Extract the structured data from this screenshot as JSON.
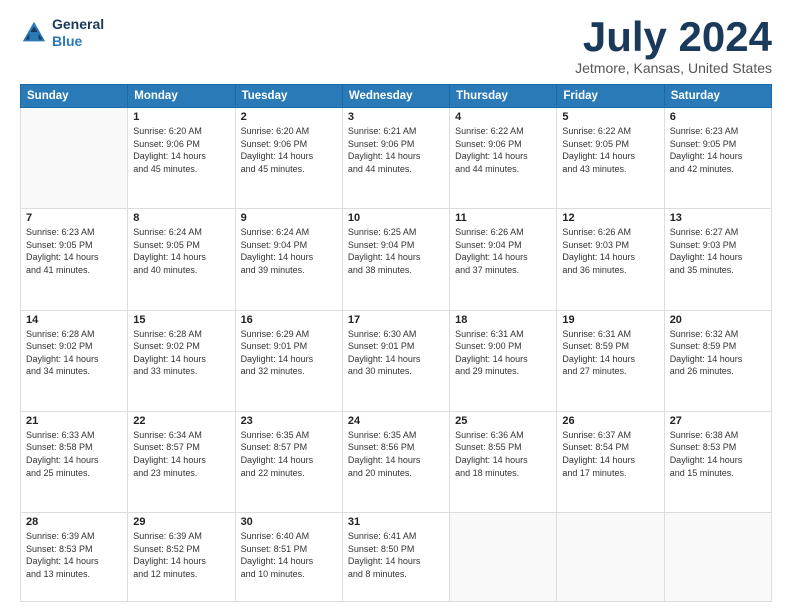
{
  "header": {
    "logo_line1": "General",
    "logo_line2": "Blue",
    "month": "July 2024",
    "location": "Jetmore, Kansas, United States"
  },
  "weekdays": [
    "Sunday",
    "Monday",
    "Tuesday",
    "Wednesday",
    "Thursday",
    "Friday",
    "Saturday"
  ],
  "weeks": [
    [
      {
        "day": "",
        "info": ""
      },
      {
        "day": "1",
        "info": "Sunrise: 6:20 AM\nSunset: 9:06 PM\nDaylight: 14 hours\nand 45 minutes."
      },
      {
        "day": "2",
        "info": "Sunrise: 6:20 AM\nSunset: 9:06 PM\nDaylight: 14 hours\nand 45 minutes."
      },
      {
        "day": "3",
        "info": "Sunrise: 6:21 AM\nSunset: 9:06 PM\nDaylight: 14 hours\nand 44 minutes."
      },
      {
        "day": "4",
        "info": "Sunrise: 6:22 AM\nSunset: 9:06 PM\nDaylight: 14 hours\nand 44 minutes."
      },
      {
        "day": "5",
        "info": "Sunrise: 6:22 AM\nSunset: 9:05 PM\nDaylight: 14 hours\nand 43 minutes."
      },
      {
        "day": "6",
        "info": "Sunrise: 6:23 AM\nSunset: 9:05 PM\nDaylight: 14 hours\nand 42 minutes."
      }
    ],
    [
      {
        "day": "7",
        "info": "Sunrise: 6:23 AM\nSunset: 9:05 PM\nDaylight: 14 hours\nand 41 minutes."
      },
      {
        "day": "8",
        "info": "Sunrise: 6:24 AM\nSunset: 9:05 PM\nDaylight: 14 hours\nand 40 minutes."
      },
      {
        "day": "9",
        "info": "Sunrise: 6:24 AM\nSunset: 9:04 PM\nDaylight: 14 hours\nand 39 minutes."
      },
      {
        "day": "10",
        "info": "Sunrise: 6:25 AM\nSunset: 9:04 PM\nDaylight: 14 hours\nand 38 minutes."
      },
      {
        "day": "11",
        "info": "Sunrise: 6:26 AM\nSunset: 9:04 PM\nDaylight: 14 hours\nand 37 minutes."
      },
      {
        "day": "12",
        "info": "Sunrise: 6:26 AM\nSunset: 9:03 PM\nDaylight: 14 hours\nand 36 minutes."
      },
      {
        "day": "13",
        "info": "Sunrise: 6:27 AM\nSunset: 9:03 PM\nDaylight: 14 hours\nand 35 minutes."
      }
    ],
    [
      {
        "day": "14",
        "info": "Sunrise: 6:28 AM\nSunset: 9:02 PM\nDaylight: 14 hours\nand 34 minutes."
      },
      {
        "day": "15",
        "info": "Sunrise: 6:28 AM\nSunset: 9:02 PM\nDaylight: 14 hours\nand 33 minutes."
      },
      {
        "day": "16",
        "info": "Sunrise: 6:29 AM\nSunset: 9:01 PM\nDaylight: 14 hours\nand 32 minutes."
      },
      {
        "day": "17",
        "info": "Sunrise: 6:30 AM\nSunset: 9:01 PM\nDaylight: 14 hours\nand 30 minutes."
      },
      {
        "day": "18",
        "info": "Sunrise: 6:31 AM\nSunset: 9:00 PM\nDaylight: 14 hours\nand 29 minutes."
      },
      {
        "day": "19",
        "info": "Sunrise: 6:31 AM\nSunset: 8:59 PM\nDaylight: 14 hours\nand 27 minutes."
      },
      {
        "day": "20",
        "info": "Sunrise: 6:32 AM\nSunset: 8:59 PM\nDaylight: 14 hours\nand 26 minutes."
      }
    ],
    [
      {
        "day": "21",
        "info": "Sunrise: 6:33 AM\nSunset: 8:58 PM\nDaylight: 14 hours\nand 25 minutes."
      },
      {
        "day": "22",
        "info": "Sunrise: 6:34 AM\nSunset: 8:57 PM\nDaylight: 14 hours\nand 23 minutes."
      },
      {
        "day": "23",
        "info": "Sunrise: 6:35 AM\nSunset: 8:57 PM\nDaylight: 14 hours\nand 22 minutes."
      },
      {
        "day": "24",
        "info": "Sunrise: 6:35 AM\nSunset: 8:56 PM\nDaylight: 14 hours\nand 20 minutes."
      },
      {
        "day": "25",
        "info": "Sunrise: 6:36 AM\nSunset: 8:55 PM\nDaylight: 14 hours\nand 18 minutes."
      },
      {
        "day": "26",
        "info": "Sunrise: 6:37 AM\nSunset: 8:54 PM\nDaylight: 14 hours\nand 17 minutes."
      },
      {
        "day": "27",
        "info": "Sunrise: 6:38 AM\nSunset: 8:53 PM\nDaylight: 14 hours\nand 15 minutes."
      }
    ],
    [
      {
        "day": "28",
        "info": "Sunrise: 6:39 AM\nSunset: 8:53 PM\nDaylight: 14 hours\nand 13 minutes."
      },
      {
        "day": "29",
        "info": "Sunrise: 6:39 AM\nSunset: 8:52 PM\nDaylight: 14 hours\nand 12 minutes."
      },
      {
        "day": "30",
        "info": "Sunrise: 6:40 AM\nSunset: 8:51 PM\nDaylight: 14 hours\nand 10 minutes."
      },
      {
        "day": "31",
        "info": "Sunrise: 6:41 AM\nSunset: 8:50 PM\nDaylight: 14 hours\nand 8 minutes."
      },
      {
        "day": "",
        "info": ""
      },
      {
        "day": "",
        "info": ""
      },
      {
        "day": "",
        "info": ""
      }
    ]
  ]
}
